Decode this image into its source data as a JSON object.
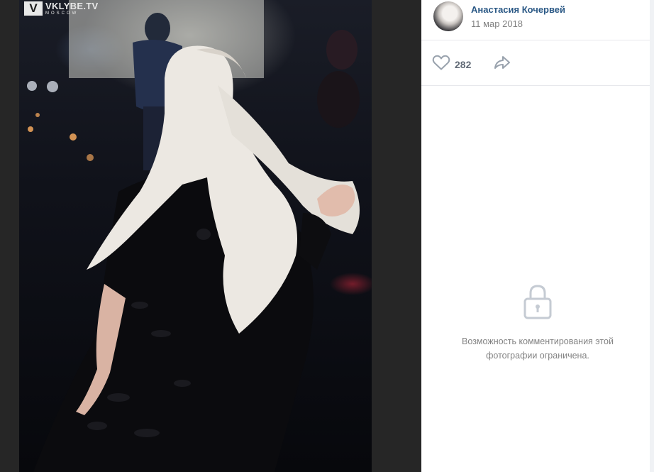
{
  "photo": {
    "watermark_logo": "V",
    "watermark_title": "VKLYBE.TV",
    "watermark_subtitle": "MOSCOW"
  },
  "post": {
    "author_name": "Анастасия Кочервей",
    "date": "11 мар 2018",
    "likes": "282"
  },
  "comments": {
    "restricted_text": "Возможность комментирования этой фотографии ограничена."
  },
  "colors": {
    "link": "#2a5885",
    "muted": "#828282",
    "icon": "#99a2ad",
    "divider": "#e7e8ec"
  },
  "icons": {
    "like": "heart-outline-icon",
    "share": "share-arrow-icon",
    "restricted": "lock-icon"
  }
}
